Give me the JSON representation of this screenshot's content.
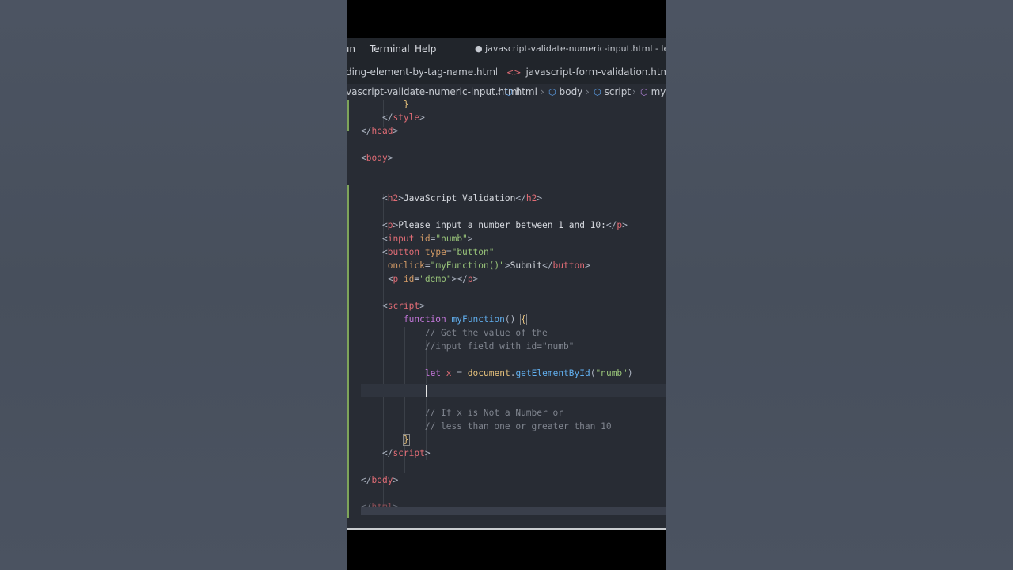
{
  "menubar": {
    "items": [
      "Run",
      "Terminal",
      "Help"
    ],
    "title": "● javascript-validate-numeric-input.html - learn_java"
  },
  "tabs": [
    {
      "label": "ding-element-by-tag-name.html"
    },
    {
      "label": "javascript-form-validation.html"
    }
  ],
  "breadcrumb": [
    "vascript-validate-numeric-input.html",
    "html",
    "body",
    "script",
    "myf"
  ],
  "code": {
    "l0": "}",
    "l1_tag": "style",
    "l2_tag": "head",
    "l3_tag": "body",
    "l4_tag": "h2",
    "l4_text": "JavaScript Validation",
    "l5_tag": "p",
    "l5_text": "Please input a number between 1 and 10:",
    "l6_tag": "input",
    "l6_attr": "id",
    "l6_val": "\"numb\"",
    "l7_tag": "button",
    "l7_attr": "type",
    "l7_val": "\"button\"",
    "l8_attr": "onclick",
    "l8_val": "\"myFunction()\"",
    "l8_text": "Submit",
    "l8_tag": "button",
    "l9_tag": "p",
    "l9_attr": "id",
    "l9_val": "\"demo\"",
    "l10_tag": "script",
    "l11_kw": "function",
    "l11_fn": "myFunction",
    "l12_comment": "// Get the value of the",
    "l13_comment": "//input field with id=\"numb\"",
    "l14_kw": "let",
    "l14_var": "x",
    "l14_obj": "document",
    "l14_fn": "getElementById",
    "l14_str": "\"numb\"",
    "l15_comment": "// If x is Not a Number or",
    "l16_comment": "// less than one or greater than 10",
    "l17_brace": "}",
    "l18_tag": "script",
    "l19_tag": "body",
    "l20_tag": "html"
  },
  "colors": {
    "editor_bg": "#282c34",
    "tag": "#e06c75",
    "attr": "#d19a66",
    "string": "#98c379",
    "keyword": "#c678dd",
    "function": "#61afef",
    "comment": "#7f848e",
    "git_modified": "#7ea45a"
  }
}
